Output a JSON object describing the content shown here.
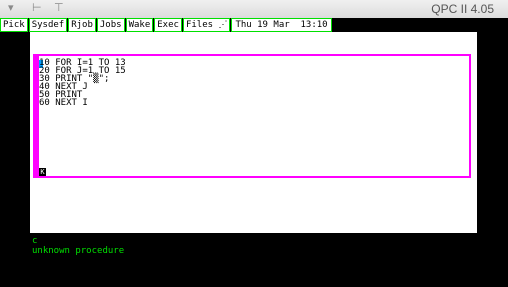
{
  "window": {
    "title": "QPC II 4.05",
    "controls": [
      "chevron-down-icon",
      "resize-handle-icon",
      "pin-icon"
    ]
  },
  "menubar": {
    "items": [
      {
        "label": "Pick"
      },
      {
        "label": "Sysdef"
      },
      {
        "label": "Rjob"
      },
      {
        "label": "Jobs"
      },
      {
        "label": "Wake"
      },
      {
        "label": "Exec"
      },
      {
        "label": "Files ⋰"
      }
    ],
    "clock": "Thu 19 Mar  13:10"
  },
  "editor": {
    "lines": [
      "10 FOR I=1 TO 13",
      "20 FOR J=1 TO 15",
      "30 PRINT \"▒\";",
      "40 NEXT J",
      "50 PRINT",
      "60 NEXT I"
    ],
    "cursor_glyph": "K"
  },
  "command": {
    "lines": [
      "c",
      "unknown procedure"
    ]
  },
  "colors": {
    "accent_border": "#ff00ff",
    "menu_border": "#00e000",
    "command_text": "#00e000",
    "cursor_block": "#00a0ff"
  }
}
